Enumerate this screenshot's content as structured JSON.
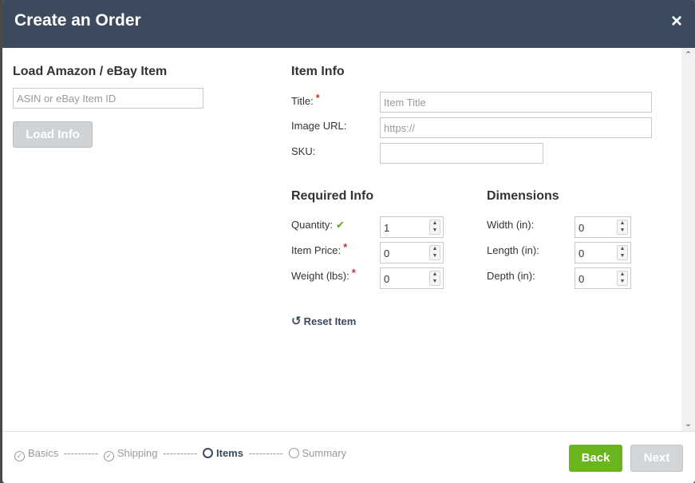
{
  "header": {
    "title": "Create an Order",
    "close_icon": "×"
  },
  "load_section": {
    "title": "Load Amazon / eBay Item",
    "input_placeholder": "ASIN or eBay Item ID",
    "button_label": "Load Info"
  },
  "item_info": {
    "title": "Item Info",
    "title_label": "Title:",
    "title_placeholder": "Item Title",
    "image_label": "Image URL:",
    "image_placeholder": "https://",
    "sku_label": "SKU:"
  },
  "required_info": {
    "title": "Required Info",
    "quantity_label": "Quantity:",
    "quantity_value": "1",
    "price_label": "Item Price:",
    "price_value": "0",
    "weight_label": "Weight (lbs):",
    "weight_value": "0"
  },
  "dimensions": {
    "title": "Dimensions",
    "width_label": "Width (in):",
    "width_value": "0",
    "length_label": "Length (in):",
    "length_value": "0",
    "depth_label": "Depth (in):",
    "depth_value": "0"
  },
  "reset_label": "Reset Item",
  "stepper": {
    "steps": [
      "Basics",
      "Shipping",
      "Items",
      "Summary"
    ],
    "separator": "----------"
  },
  "footer": {
    "back_label": "Back",
    "next_label": "Next"
  },
  "colors": {
    "header_bg": "#3c4a5e",
    "accent_green": "#6ab41e",
    "required_red": "#c0392b",
    "check_green": "#6ca51e"
  }
}
